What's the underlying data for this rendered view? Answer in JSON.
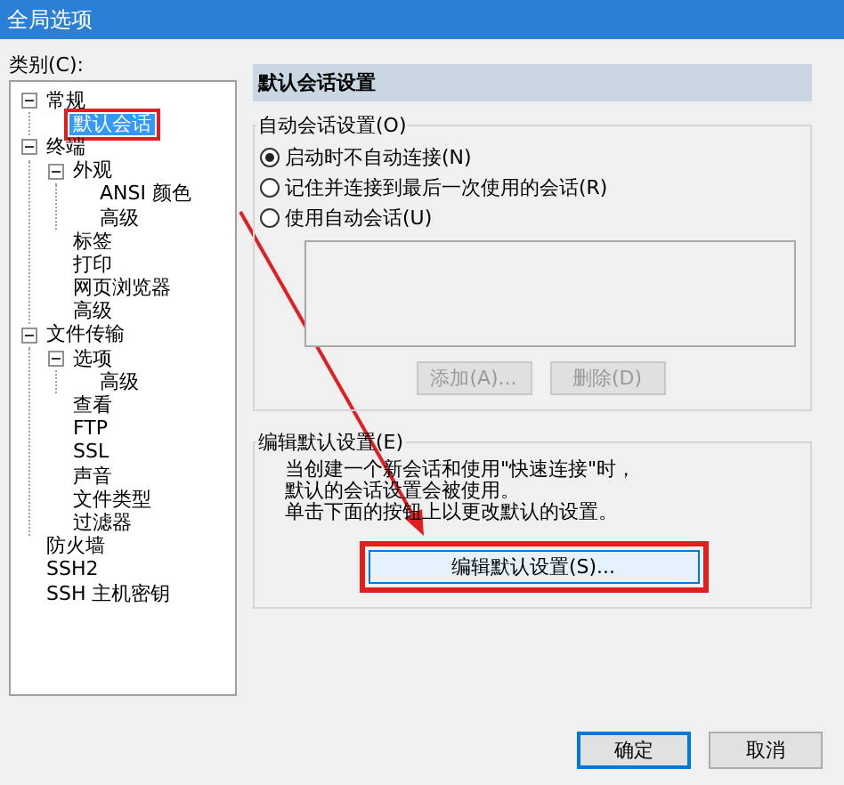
{
  "window": {
    "title": "全局选项"
  },
  "category_label": "类别(C):",
  "tree": [
    {
      "label": "常规",
      "selected": false,
      "expanded": true,
      "children": [
        {
          "label": "默认会话",
          "selected": true,
          "highlighted": true
        }
      ]
    },
    {
      "label": "终端",
      "selected": false,
      "expanded": true,
      "children": [
        {
          "label": "外观",
          "selected": false,
          "expanded": true,
          "children": [
            {
              "label": "ANSI 颜色",
              "selected": false
            },
            {
              "label": "高级",
              "selected": false
            }
          ]
        },
        {
          "label": "标签",
          "selected": false
        },
        {
          "label": "打印",
          "selected": false
        },
        {
          "label": "网页浏览器",
          "selected": false
        },
        {
          "label": "高级",
          "selected": false
        }
      ]
    },
    {
      "label": "文件传输",
      "selected": false,
      "expanded": true,
      "children": [
        {
          "label": "选项",
          "selected": false,
          "expanded": true,
          "children": [
            {
              "label": "高级",
              "selected": false
            }
          ]
        },
        {
          "label": "查看",
          "selected": false
        },
        {
          "label": "FTP",
          "selected": false
        },
        {
          "label": "SSL",
          "selected": false
        },
        {
          "label": "声音",
          "selected": false
        },
        {
          "label": "文件类型",
          "selected": false
        },
        {
          "label": "过滤器",
          "selected": false
        }
      ]
    },
    {
      "label": "防火墙",
      "selected": false
    },
    {
      "label": "SSH2",
      "selected": false
    },
    {
      "label": "SSH 主机密钥",
      "selected": false
    }
  ],
  "panel": {
    "header": "默认会话设置",
    "auto_group": {
      "title": "自动会话设置(O)",
      "options": [
        {
          "label": "启动时不自动连接(N)",
          "selected": true
        },
        {
          "label": "记住并连接到最后一次使用的会话(R)",
          "selected": false
        },
        {
          "label": "使用自动会话(U)",
          "selected": false
        }
      ],
      "buttons": [
        {
          "label": "添加(A)...",
          "disabled": true
        },
        {
          "label": "删除(D)",
          "disabled": true
        }
      ]
    },
    "edit_group": {
      "title": "编辑默认设置(E)",
      "lines": [
        "当创建一个新会话和使用\"快速连接\"时，",
        "默认的会话设置会被使用。",
        "单击下面的按钮上以更改默认的设置。"
      ],
      "button": {
        "label": "编辑默认设置(S)...",
        "highlighted": true
      }
    }
  },
  "buttons": [
    {
      "label": "确定",
      "default": true
    },
    {
      "label": "取消",
      "default": false
    }
  ]
}
